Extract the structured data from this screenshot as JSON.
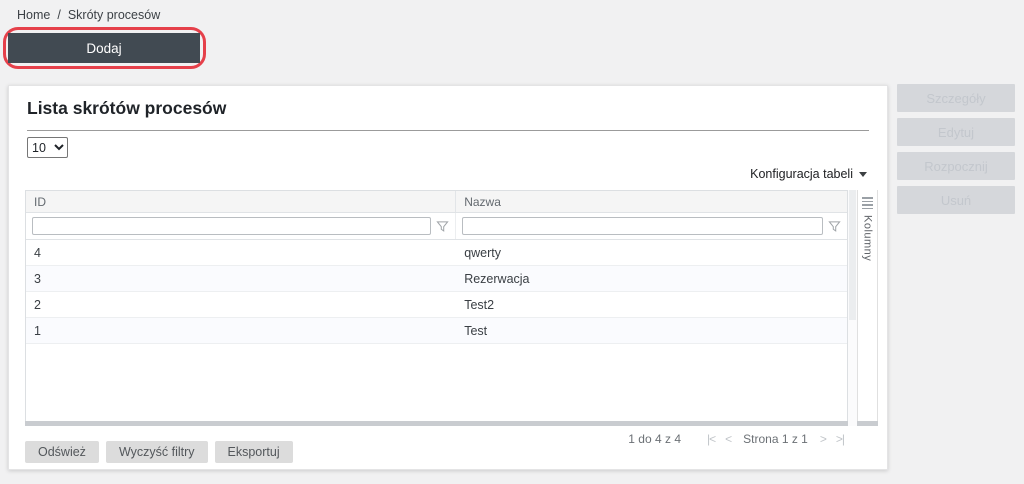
{
  "breadcrumb": {
    "home": "Home",
    "separator": "/",
    "current": "Skróty procesów"
  },
  "toolbar": {
    "add_label": "Dodaj"
  },
  "panel": {
    "title": "Lista skrótów procesów",
    "page_size": "10",
    "table_config_label": "Konfiguracja tabeli",
    "columns_tab_label": "Kolumny"
  },
  "table": {
    "columns": [
      {
        "label": "ID"
      },
      {
        "label": "Nazwa"
      }
    ],
    "filters": [
      {
        "value": ""
      },
      {
        "value": ""
      }
    ],
    "rows": [
      {
        "id": "4",
        "nazwa": "qwerty"
      },
      {
        "id": "3",
        "nazwa": "Rezerwacja"
      },
      {
        "id": "2",
        "nazwa": "Test2"
      },
      {
        "id": "1",
        "nazwa": "Test"
      }
    ]
  },
  "pagination": {
    "range_label": "1 do 4 z 4",
    "first_label": "|<",
    "prev_label": "<",
    "page_label": "Strona 1 z 1",
    "next_label": ">",
    "last_label": ">|"
  },
  "footer": {
    "buttons": [
      {
        "label": "Odśwież"
      },
      {
        "label": "Wyczyść filtry"
      },
      {
        "label": "Eksportuj"
      }
    ]
  },
  "actions": {
    "buttons": [
      {
        "label": "Szczegóły"
      },
      {
        "label": "Edytuj"
      },
      {
        "label": "Rozpocznij"
      },
      {
        "label": "Usuń"
      }
    ]
  },
  "colors": {
    "primary_dark": "#414a52",
    "annotation_red": "#e5404a",
    "disabled_bg": "#d5d7db",
    "disabled_text": "#c3c7cd"
  }
}
